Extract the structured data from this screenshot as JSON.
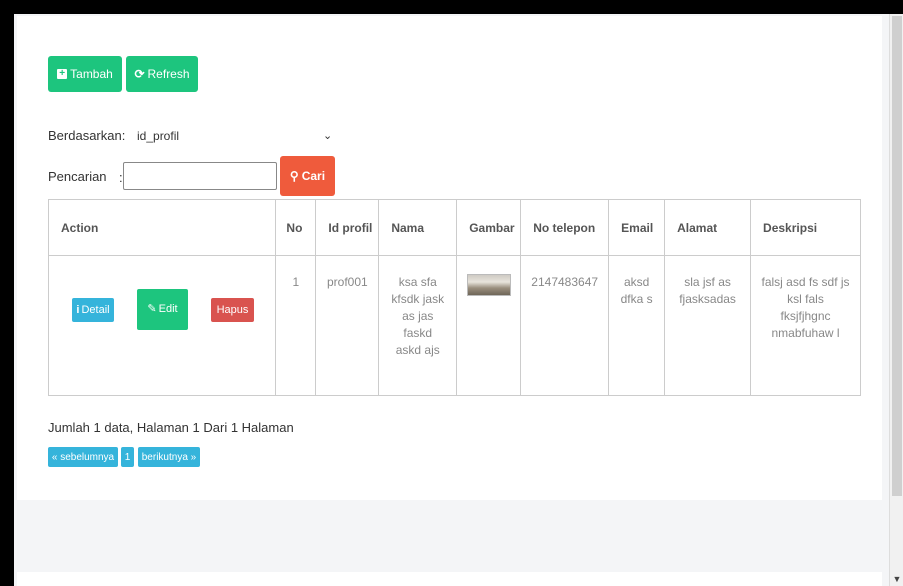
{
  "toolbar": {
    "add_label": "Tambah",
    "refresh_label": "Refresh"
  },
  "filter": {
    "by_label": "Berdasarkan:",
    "by_value": "id_profil",
    "search_label": "Pencarian",
    "search_colon": ":",
    "search_value": "",
    "search_button": "Cari"
  },
  "table": {
    "headers": [
      "Action",
      "No",
      "Id profil",
      "Nama",
      "Gambar",
      "No telepon",
      "Email",
      "Alamat",
      "Deskripsi"
    ],
    "rows": [
      {
        "actions": {
          "detail": "Detail",
          "edit": "Edit",
          "delete": "Hapus"
        },
        "no": "1",
        "id_profil": "prof001",
        "nama": "ksa sfa kfsdk jask as jas faskd askd ajs",
        "no_telepon": "2147483647",
        "email": "aksd dfka s",
        "alamat": "sla jsf as fjasksadas",
        "deskripsi": "falsj asd fs sdf js ksl fals fksjfjhgnc nmabfuhaw l"
      }
    ]
  },
  "footer": {
    "summary": "Jumlah 1 data, Halaman 1 Dari 1 Halaman",
    "prev_label": "« sebelumnya",
    "page": "1",
    "next_label": "berikutnya »"
  }
}
